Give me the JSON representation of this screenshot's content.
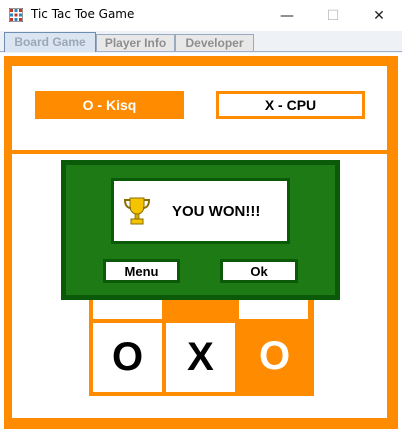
{
  "window": {
    "title": "Tic Tac Toe Game",
    "controls": {
      "minimize": "—",
      "maximize": "☐",
      "close": "✕"
    }
  },
  "tabs": [
    {
      "label": "Board Game",
      "selected": true
    },
    {
      "label": "Player Info",
      "selected": false
    },
    {
      "label": "Developer",
      "selected": false
    }
  ],
  "players": {
    "player1": "O - Kisq",
    "player2": "X - CPU"
  },
  "board": {
    "bottom_row": [
      "O",
      "X",
      "O"
    ]
  },
  "dialog": {
    "message": "YOU WON!!!",
    "menu_button": "Menu",
    "ok_button": "Ok"
  },
  "colors": {
    "accent": "#ff8c00",
    "dialog_green": "#1e7a14",
    "dialog_border": "#0a5a0a"
  }
}
